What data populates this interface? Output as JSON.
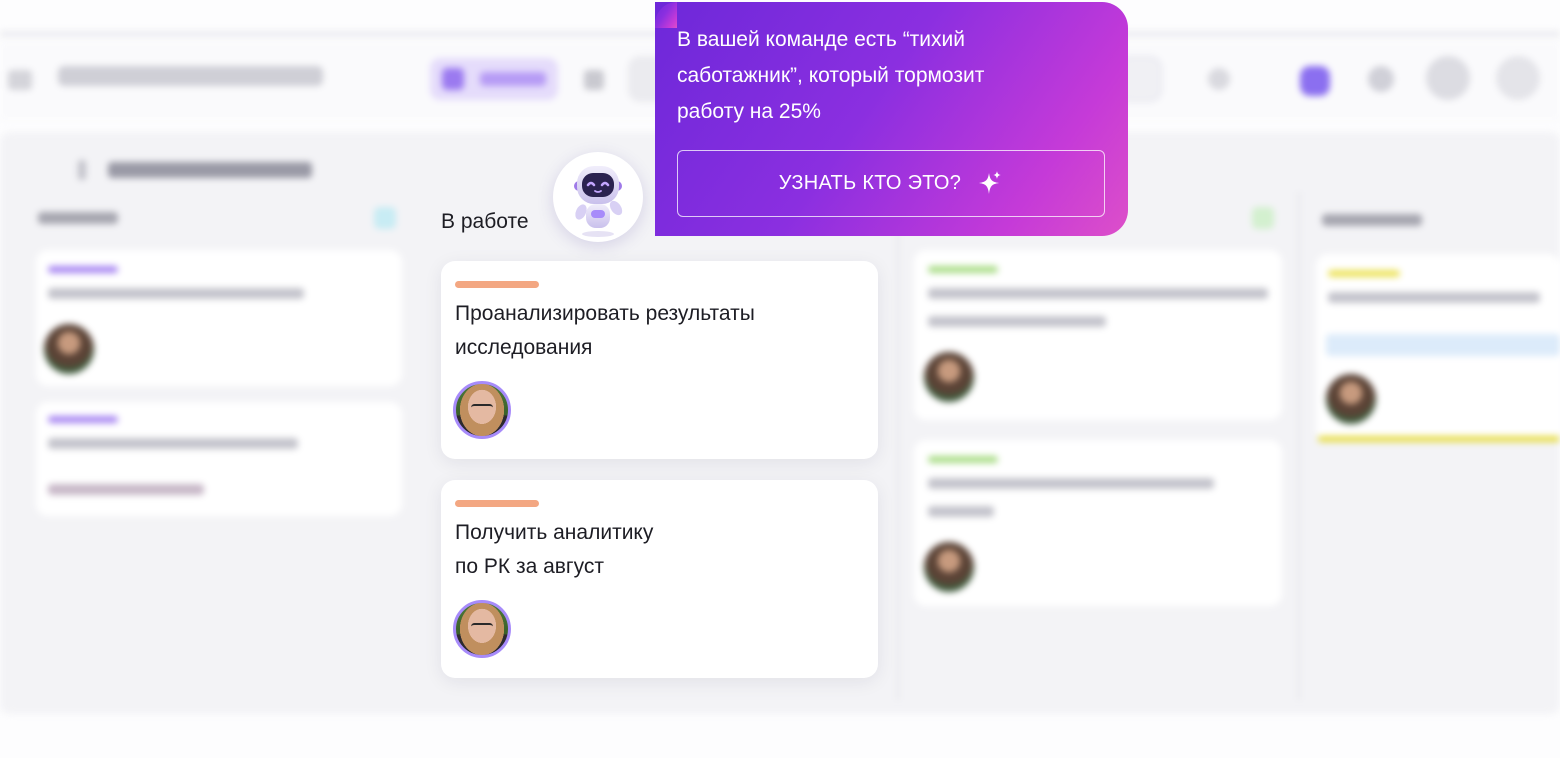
{
  "board": {
    "active_column": {
      "label": "В работе",
      "cards": [
        {
          "title": "Проанализировать результаты\nисследования"
        },
        {
          "title": "Получить аналитику\nпо РК за август"
        }
      ]
    }
  },
  "assistant": {
    "avatar_icon": "robot-assistant-icon",
    "message": "В вашей команде есть “тихий\nсаботажник”, который тормозит\nработу на 25%",
    "cta_label": "УЗНАТЬ КТО ЭТО?",
    "cta_icon": "sparkle-icon"
  },
  "colors": {
    "popup_gradient_start": "#6d28d9",
    "popup_gradient_end": "#dd4fc9",
    "card_tag": "#f3a782",
    "avatar_ring": "#a78bfa"
  }
}
